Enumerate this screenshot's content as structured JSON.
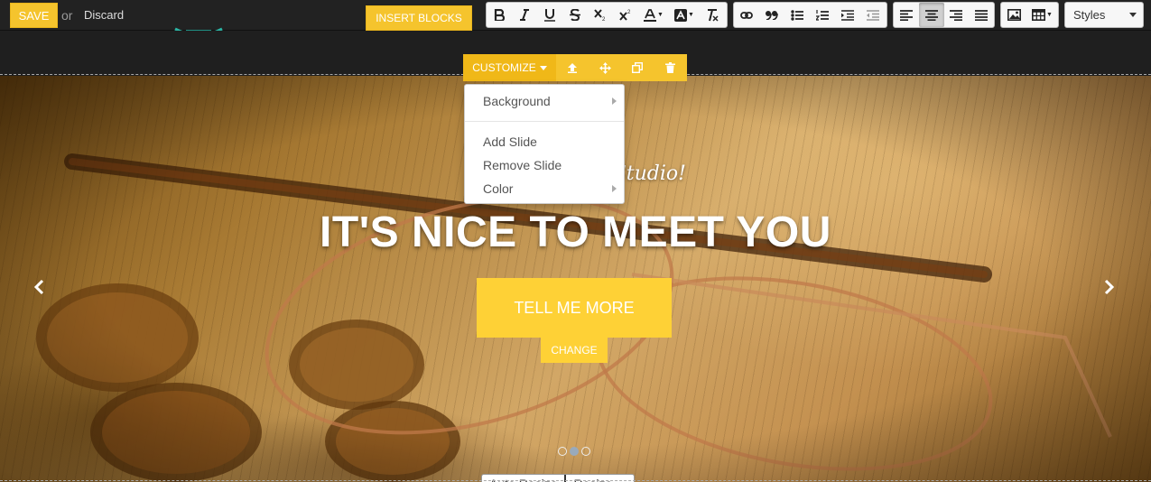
{
  "editor": {
    "save_label": "SAVE",
    "or_text": "or",
    "discard_label": "Discard",
    "insert_blocks_label": "INSERT BLOCKS",
    "styles_label": "Styles"
  },
  "toolbar_icons": {
    "format": [
      "bold-icon",
      "italic-icon",
      "underline-icon",
      "strikethrough-icon",
      "subscript-icon",
      "superscript-icon",
      "text-color-icon",
      "background-color-icon",
      "clear-format-icon"
    ],
    "insert": [
      "link-icon",
      "quote-icon",
      "bulleted-list-icon",
      "numbered-list-icon",
      "indent-icon",
      "outdent-icon"
    ],
    "align": [
      "align-left-icon",
      "align-center-icon",
      "align-right-icon",
      "align-justify-icon"
    ],
    "media": [
      "image-icon",
      "table-icon"
    ],
    "active_align": "align-center-icon"
  },
  "snippet_bar": {
    "customize_label": "CUSTOMIZE",
    "icons": [
      "move-up-icon",
      "move-icon",
      "clone-icon",
      "delete-icon"
    ],
    "accent_color": "#f5c42d"
  },
  "customize_menu": {
    "items": [
      {
        "label": "Background",
        "has_submenu": true
      },
      {
        "label": "Add Slide",
        "has_submenu": false
      },
      {
        "label": "Remove Slide",
        "has_submenu": false
      },
      {
        "label": "Color",
        "has_submenu": true
      }
    ]
  },
  "hero": {
    "subtitle": "Studio!",
    "title": "IT'S NICE TO MEET YOU",
    "cta_label": "TELL ME MORE",
    "change_label": "CHANGE",
    "button_color": "#fed136",
    "slide_count": 3,
    "active_slide": 2
  },
  "resize_controls": {
    "auto_resize_label": "Auto Resize",
    "resize_label": "Resize"
  }
}
